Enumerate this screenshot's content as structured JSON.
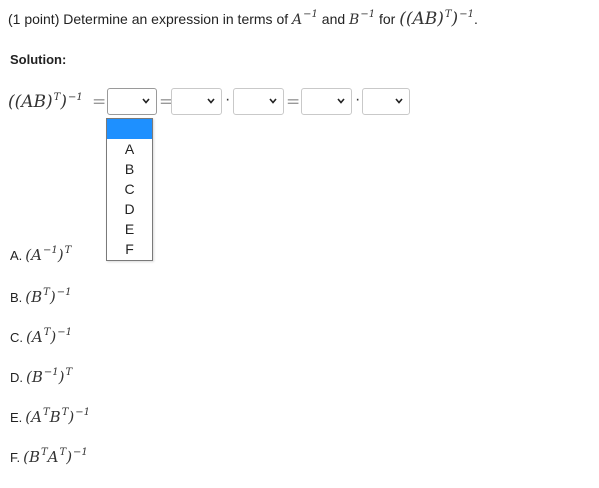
{
  "problem": {
    "points": "(1 point)",
    "text1": "Determine an expression in terms of",
    "a_inv_base": "A",
    "a_inv_exp": "−1",
    "and": "and",
    "b_inv_base": "B",
    "b_inv_exp": "−1",
    "for": "for",
    "target_inner": "((AB)",
    "target_T": "T",
    "target_close": ")",
    "target_exp": "−1",
    "period": "."
  },
  "solution": {
    "label": "Solution:",
    "lhs_inner": "((AB)",
    "lhs_T": "T",
    "lhs_close": ")",
    "lhs_exp": "−1",
    "equals": "=",
    "dot": "·",
    "selects": [
      {
        "value": "",
        "expanded": true
      },
      {
        "value": "",
        "expanded": false
      },
      {
        "value": "",
        "expanded": false
      },
      {
        "value": "",
        "expanded": false
      },
      {
        "value": "",
        "expanded": false
      }
    ],
    "dropdown_options": [
      "",
      "A",
      "B",
      "C",
      "D",
      "E",
      "F"
    ]
  },
  "choices": [
    {
      "label": "A.",
      "expr": "(A",
      "sup1": "−1",
      "mid": ")",
      "sup2": "T"
    },
    {
      "label": "B.",
      "expr": "(B",
      "sup1": "T",
      "mid": ")",
      "sup2": "−1"
    },
    {
      "label": "C.",
      "expr": "(A",
      "sup1": "T",
      "mid": ")",
      "sup2": "−1"
    },
    {
      "label": "D.",
      "expr": "(B",
      "sup1": "−1",
      "mid": ")",
      "sup2": "T"
    },
    {
      "label": "E.",
      "expr": "(A",
      "sup1": "T",
      "mid": "B",
      "sup2": "T",
      "close": ")",
      "sup3": "−1"
    },
    {
      "label": "F.",
      "expr": "(B",
      "sup1": "T",
      "mid": "A",
      "sup2": "T",
      "close": ")",
      "sup3": "−1"
    }
  ],
  "colors": {
    "highlight": "#1e90ff",
    "border": "#c9c9c9"
  },
  "icons": {
    "select_arrow": "chevron-down-icon"
  }
}
